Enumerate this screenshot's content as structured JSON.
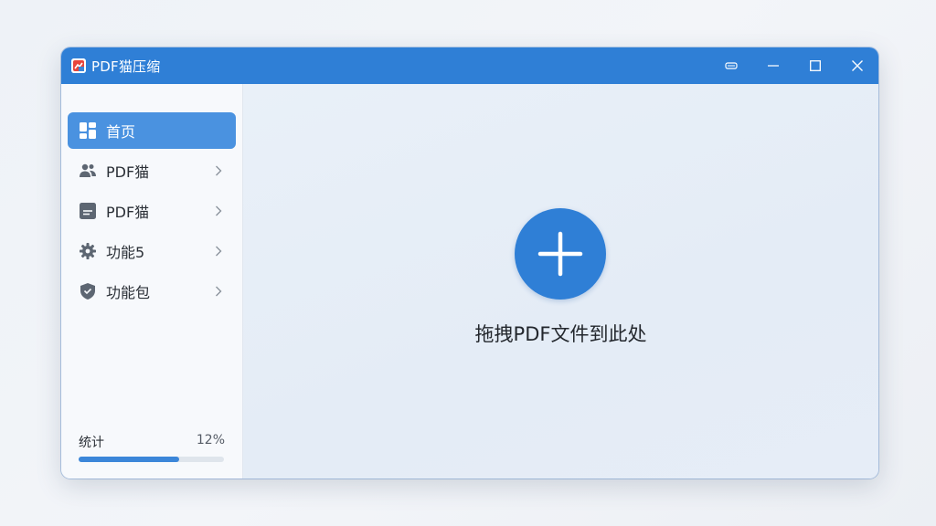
{
  "window": {
    "title": "PDF猫压缩"
  },
  "sidebar": {
    "items": [
      {
        "label": "首页",
        "icon": "dashboard-icon",
        "active": true,
        "chevron": false
      },
      {
        "label": "PDF猫",
        "icon": "users-icon",
        "active": false,
        "chevron": true
      },
      {
        "label": "PDF猫",
        "icon": "document-icon",
        "active": false,
        "chevron": true
      },
      {
        "label": "功能5",
        "icon": "gear-icon",
        "active": false,
        "chevron": true
      },
      {
        "label": "功能包",
        "icon": "shield-icon",
        "active": false,
        "chevron": true
      }
    ],
    "storage": {
      "label": "统计",
      "value": "12%",
      "progress": 0.69
    }
  },
  "main": {
    "drop_text": "拖拽PDF文件到此处"
  },
  "colors": {
    "accent": "#2f7fd6",
    "active_item": "#4a92e0"
  }
}
